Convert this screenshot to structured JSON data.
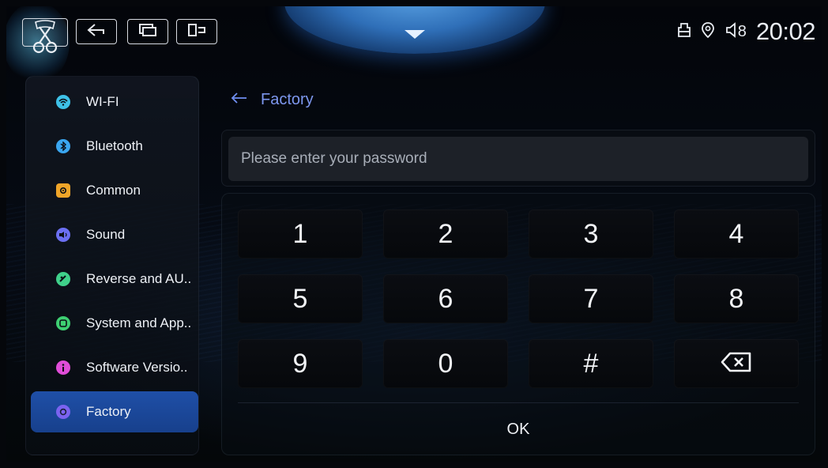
{
  "topbar": {
    "buttons": [
      {
        "name": "home-button",
        "icon": "scissors-home-icon"
      },
      {
        "name": "back-button",
        "icon": "back-arrow-icon"
      },
      {
        "name": "recent-apps-button",
        "icon": "recent-apps-icon"
      },
      {
        "name": "split-screen-button",
        "icon": "split-screen-icon"
      }
    ],
    "pull_down_icon": "chevron-down-icon",
    "status_icons": [
      "usb-icon",
      "location-icon",
      "volume-icon"
    ],
    "volume_level": "8",
    "clock": "20:02"
  },
  "sidebar": {
    "items": [
      {
        "label": "WI-FI",
        "icon": "wifi-icon",
        "icon_color": "#3ec1e8"
      },
      {
        "label": "Bluetooth",
        "icon": "bluetooth-icon",
        "icon_color": "#3aa6f0"
      },
      {
        "label": "Common",
        "icon": "gear-icon",
        "icon_color": "#f0a529"
      },
      {
        "label": "Sound",
        "icon": "speaker-icon",
        "icon_color": "#6b6ff2"
      },
      {
        "label": "Reverse and AU..",
        "icon": "camera-icon",
        "icon_color": "#3fd08a"
      },
      {
        "label": "System and App..",
        "icon": "apps-icon",
        "icon_color": "#3ecf72"
      },
      {
        "label": "Software Versio..",
        "icon": "info-icon",
        "icon_color": "#e04dd8"
      },
      {
        "label": "Factory",
        "icon": "factory-icon",
        "icon_color": "#7b63f0",
        "active": true
      }
    ]
  },
  "main": {
    "breadcrumb": {
      "back_icon": "back-arrow-icon",
      "title": "Factory"
    },
    "password_placeholder": "Please enter your password",
    "keys": [
      "1",
      "2",
      "3",
      "4",
      "5",
      "6",
      "7",
      "8",
      "9",
      "0",
      "#",
      "⌫"
    ],
    "ok_label": "OK"
  },
  "colors": {
    "accent": "#1f4fa7",
    "breadcrumb": "#7d97ee",
    "background": "#05070b"
  }
}
